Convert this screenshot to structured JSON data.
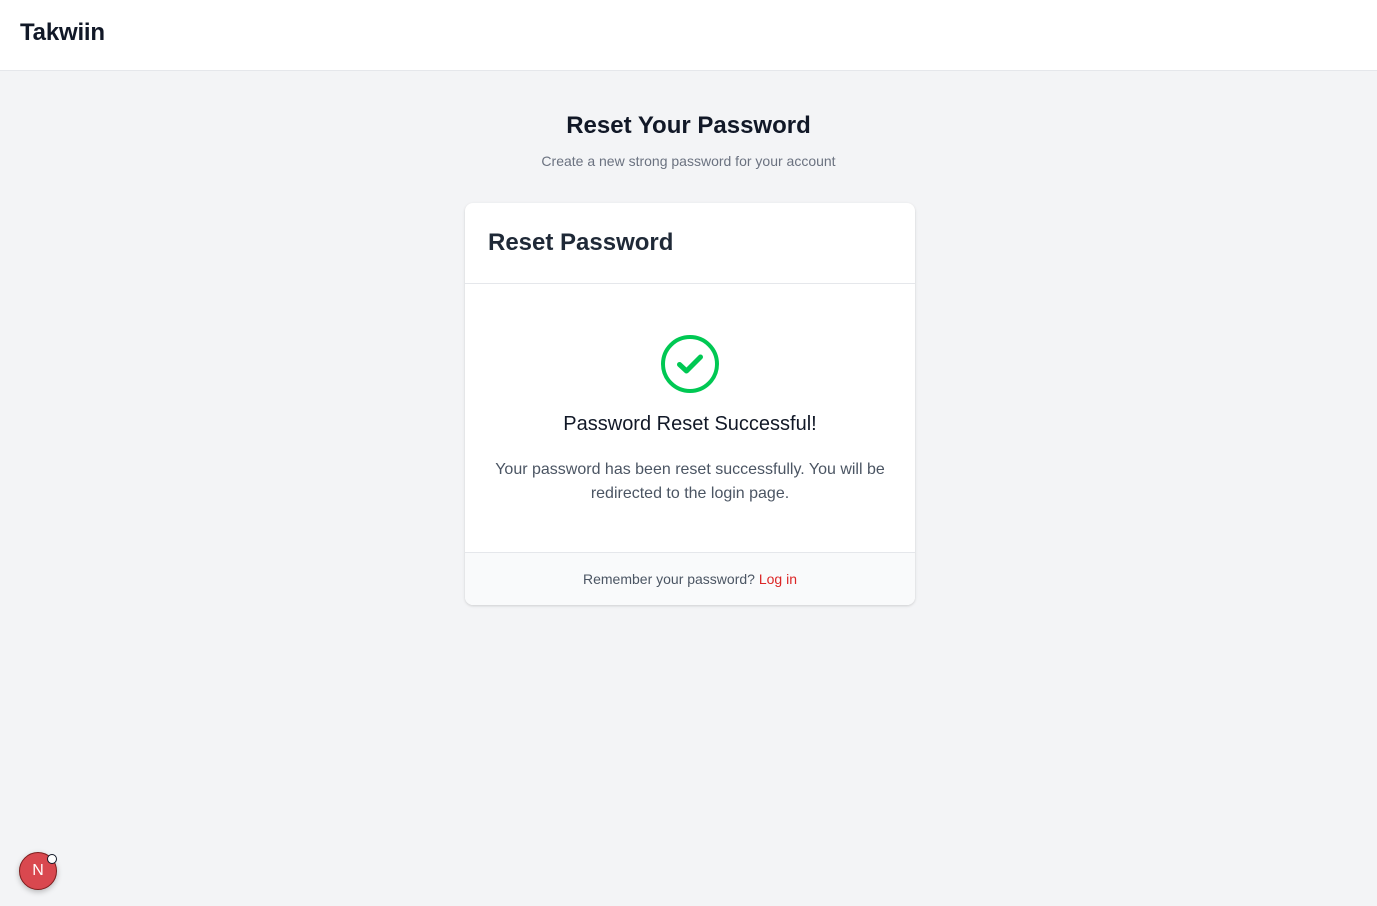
{
  "header": {
    "brand": "Takwiin"
  },
  "page": {
    "title": "Reset Your Password",
    "subtitle": "Create a new strong password for your account"
  },
  "card": {
    "title": "Reset Password",
    "success_title": "Password Reset Successful!",
    "success_message": "Your password has been reset successfully. You will be redirected to the login page.",
    "footer_text": "Remember your password?",
    "login_link": "Log in"
  },
  "icons": {
    "success": "check-circle-icon"
  },
  "colors": {
    "success": "#00c853",
    "link": "#dc2626",
    "badge": "#d9484f"
  },
  "dev_badge": {
    "letter": "N"
  }
}
